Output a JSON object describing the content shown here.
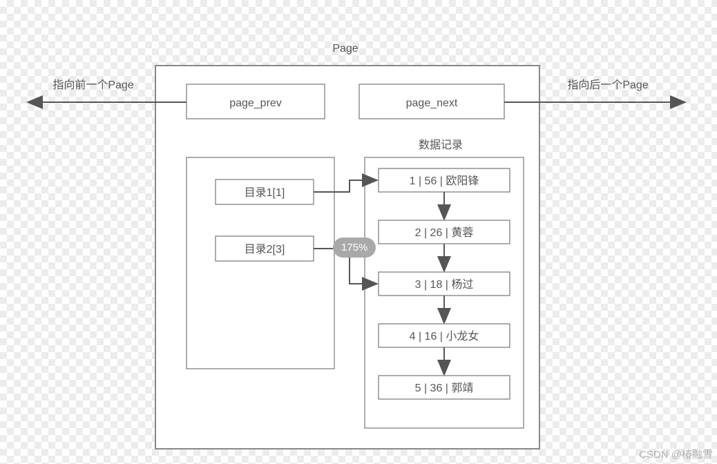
{
  "title": "Page",
  "prev_label": "指向前一个Page",
  "next_label": "指向后一个Page",
  "page_prev_label": "page_prev",
  "page_next_label": "page_next",
  "dir_section_items": [
    "目录1[1]",
    "目录2[3]"
  ],
  "records_title": "数据记录",
  "records": [
    {
      "id": 1,
      "age": 56,
      "name": "欧阳锋"
    },
    {
      "id": 2,
      "age": 26,
      "name": "黄蓉"
    },
    {
      "id": 3,
      "age": 18,
      "name": "杨过"
    },
    {
      "id": 4,
      "age": 16,
      "name": "小龙女"
    },
    {
      "id": 5,
      "age": 36,
      "name": "郭靖"
    }
  ],
  "record_separator": " | ",
  "dir_links": [
    {
      "dir_index": 0,
      "record_index": 0
    },
    {
      "dir_index": 1,
      "record_index": 2
    }
  ],
  "zoom_level": "175%",
  "watermark": "CSDN @椿融雪"
}
